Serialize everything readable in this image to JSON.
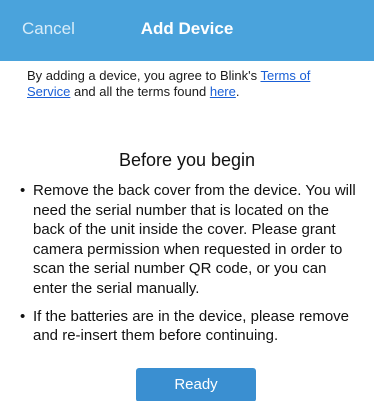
{
  "navbar": {
    "cancel_label": "Cancel",
    "title": "Add Device"
  },
  "agreement": {
    "text_before": "By adding a device, you agree to Blink's ",
    "terms_link": "Terms of Service",
    "text_middle": " and all the terms found ",
    "here_link": "here",
    "text_after": "."
  },
  "intro": {
    "title": "Before you begin",
    "bullets": [
      "Remove the back cover from the device. You will need the serial number that is located on the back of the unit inside the cover. Please grant camera permission when requested in order to scan the serial number QR code, or you can enter the serial manually.",
      "If the batteries are in the device, please remove and re-insert them before continuing."
    ]
  },
  "actions": {
    "ready_label": "Ready"
  },
  "colors": {
    "navbar": "#4aa3dc",
    "button": "#3a8fd1",
    "link": "#1a5fd6"
  }
}
